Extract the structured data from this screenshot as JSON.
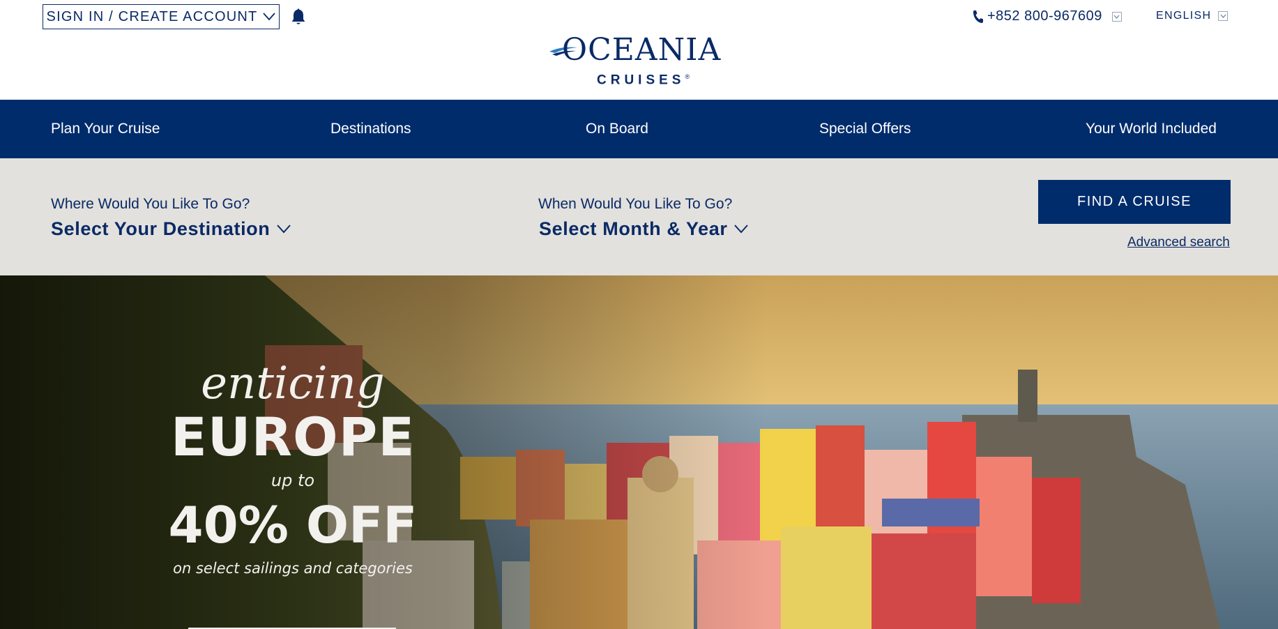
{
  "header": {
    "signin_label": "SIGN IN / CREATE ACCOUNT",
    "phone": "+852 800-967609",
    "language": "ENGLISH",
    "logo": {
      "main": "OCEANIA",
      "sub": "CRUISES",
      "reg": "®"
    }
  },
  "nav": {
    "items": [
      {
        "label": "Plan Your Cruise"
      },
      {
        "label": "Destinations"
      },
      {
        "label": "On Board"
      },
      {
        "label": "Special Offers"
      },
      {
        "label": "Your World Included"
      }
    ]
  },
  "search": {
    "destination_label": "Where Would You Like To Go?",
    "destination_value": "Select Your Destination",
    "date_label": "When Would You Like To Go?",
    "date_value": "Select Month & Year",
    "find_button": "FIND A CRUISE",
    "advanced_link": "Advanced search"
  },
  "hero": {
    "line1": "enticing",
    "line2": "EUROPE",
    "line3": "up to",
    "line4": "40% OFF",
    "line5": "on select sailings and categories"
  },
  "colors": {
    "brand_navy": "#002c6c",
    "search_band": "#e3e1dd",
    "text_navy": "#0a2a66"
  },
  "icons": [
    "chevron-down-icon",
    "bell-icon",
    "phone-icon",
    "dropdown-icon",
    "logo-swoosh-icon"
  ]
}
